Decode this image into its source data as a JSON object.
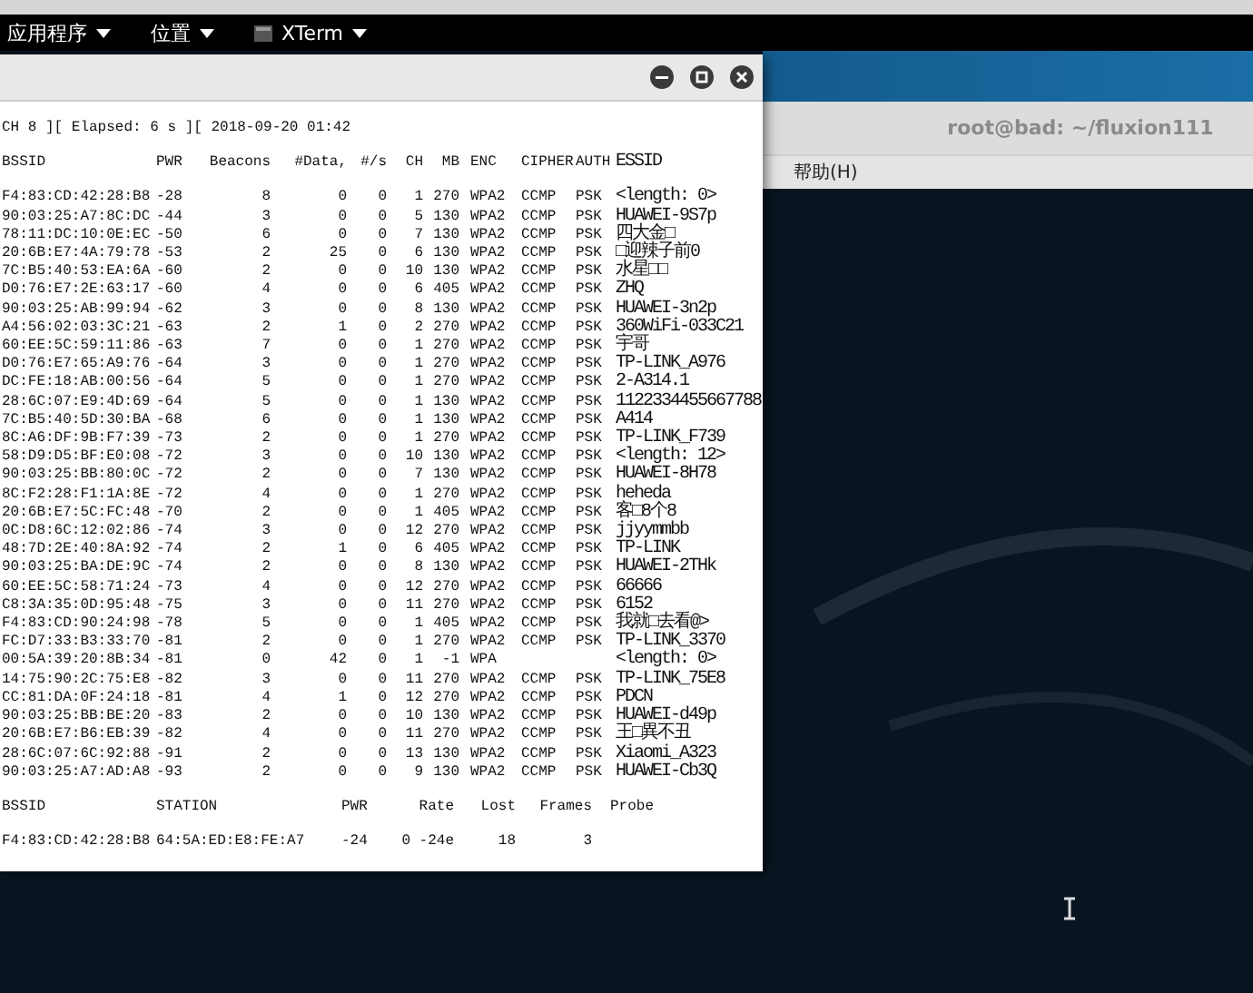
{
  "top_bar": {
    "menus": [
      {
        "label": "应用程序",
        "kind": "menu"
      },
      {
        "label": "位置",
        "kind": "menu"
      },
      {
        "label": "XTerm",
        "kind": "app"
      }
    ]
  },
  "back_window": {
    "title": "root@bad: ~/fluxion111",
    "menu": [
      "帮助(H)"
    ]
  },
  "xterm": {
    "status_line": "CH  8 ][ Elapsed: 6 s ][ 2018-09-20 01:42",
    "ap_columns": [
      "BSSID",
      "PWR",
      "Beacons",
      "#Data,",
      "#/s",
      "CH",
      "MB",
      "ENC",
      "CIPHER",
      "AUTH",
      "ESSID"
    ],
    "ap_rows": [
      {
        "bssid": "F4:83:CD:42:28:B8",
        "pwr": "-28",
        "beacons": "8",
        "data": "0",
        "per_s": "0",
        "ch": "1",
        "mb": "270",
        "enc": "WPA2",
        "cipher": "CCMP",
        "auth": "PSK",
        "essid": "<length:  0>"
      },
      {
        "bssid": "90:03:25:A7:8C:DC",
        "pwr": "-44",
        "beacons": "3",
        "data": "0",
        "per_s": "0",
        "ch": "5",
        "mb": "130",
        "enc": "WPA2",
        "cipher": "CCMP",
        "auth": "PSK",
        "essid": "HUAWEI-9S7p"
      },
      {
        "bssid": "78:11:DC:10:0E:EC",
        "pwr": "-50",
        "beacons": "6",
        "data": "0",
        "per_s": "0",
        "ch": "7",
        "mb": "130",
        "enc": "WPA2",
        "cipher": "CCMP",
        "auth": "PSK",
        "essid": "四大金□"
      },
      {
        "bssid": "20:6B:E7:4A:79:78",
        "pwr": "-53",
        "beacons": "2",
        "data": "25",
        "per_s": "0",
        "ch": "6",
        "mb": "130",
        "enc": "WPA2",
        "cipher": "CCMP",
        "auth": "PSK",
        "essid": "□迎辣子前0"
      },
      {
        "bssid": "7C:B5:40:53:EA:6A",
        "pwr": "-60",
        "beacons": "2",
        "data": "0",
        "per_s": "0",
        "ch": "10",
        "mb": "130",
        "enc": "WPA2",
        "cipher": "CCMP",
        "auth": "PSK",
        "essid": "水星□□"
      },
      {
        "bssid": "D0:76:E7:2E:63:17",
        "pwr": "-60",
        "beacons": "4",
        "data": "0",
        "per_s": "0",
        "ch": "6",
        "mb": "405",
        "enc": "WPA2",
        "cipher": "CCMP",
        "auth": "PSK",
        "essid": "ZHQ"
      },
      {
        "bssid": "90:03:25:AB:99:94",
        "pwr": "-62",
        "beacons": "3",
        "data": "0",
        "per_s": "0",
        "ch": "8",
        "mb": "130",
        "enc": "WPA2",
        "cipher": "CCMP",
        "auth": "PSK",
        "essid": "HUAWEI-3n2p"
      },
      {
        "bssid": "A4:56:02:03:3C:21",
        "pwr": "-63",
        "beacons": "2",
        "data": "1",
        "per_s": "0",
        "ch": "2",
        "mb": "270",
        "enc": "WPA2",
        "cipher": "CCMP",
        "auth": "PSK",
        "essid": "360WiFi-033C21"
      },
      {
        "bssid": "60:EE:5C:59:11:86",
        "pwr": "-63",
        "beacons": "7",
        "data": "0",
        "per_s": "0",
        "ch": "1",
        "mb": "270",
        "enc": "WPA2",
        "cipher": "CCMP",
        "auth": "PSK",
        "essid": "宇哥"
      },
      {
        "bssid": "D0:76:E7:65:A9:76",
        "pwr": "-64",
        "beacons": "3",
        "data": "0",
        "per_s": "0",
        "ch": "1",
        "mb": "270",
        "enc": "WPA2",
        "cipher": "CCMP",
        "auth": "PSK",
        "essid": "TP-LINK_A976"
      },
      {
        "bssid": "DC:FE:18:AB:00:56",
        "pwr": "-64",
        "beacons": "5",
        "data": "0",
        "per_s": "0",
        "ch": "1",
        "mb": "270",
        "enc": "WPA2",
        "cipher": "CCMP",
        "auth": "PSK",
        "essid": "2-A314.1"
      },
      {
        "bssid": "28:6C:07:E9:4D:69",
        "pwr": "-64",
        "beacons": "5",
        "data": "0",
        "per_s": "0",
        "ch": "1",
        "mb": "130",
        "enc": "WPA2",
        "cipher": "CCMP",
        "auth": "PSK",
        "essid": "1122334455667788"
      },
      {
        "bssid": "7C:B5:40:5D:30:BA",
        "pwr": "-68",
        "beacons": "6",
        "data": "0",
        "per_s": "0",
        "ch": "1",
        "mb": "130",
        "enc": "WPA2",
        "cipher": "CCMP",
        "auth": "PSK",
        "essid": "A414"
      },
      {
        "bssid": "8C:A6:DF:9B:F7:39",
        "pwr": "-73",
        "beacons": "2",
        "data": "0",
        "per_s": "0",
        "ch": "1",
        "mb": "270",
        "enc": "WPA2",
        "cipher": "CCMP",
        "auth": "PSK",
        "essid": "TP-LINK_F739"
      },
      {
        "bssid": "58:D9:D5:BF:E0:08",
        "pwr": "-72",
        "beacons": "3",
        "data": "0",
        "per_s": "0",
        "ch": "10",
        "mb": "130",
        "enc": "WPA2",
        "cipher": "CCMP",
        "auth": "PSK",
        "essid": "<length: 12>"
      },
      {
        "bssid": "90:03:25:BB:80:0C",
        "pwr": "-72",
        "beacons": "2",
        "data": "0",
        "per_s": "0",
        "ch": "7",
        "mb": "130",
        "enc": "WPA2",
        "cipher": "CCMP",
        "auth": "PSK",
        "essid": "HUAWEI-8H78"
      },
      {
        "bssid": "8C:F2:28:F1:1A:8E",
        "pwr": "-72",
        "beacons": "4",
        "data": "0",
        "per_s": "0",
        "ch": "1",
        "mb": "270",
        "enc": "WPA2",
        "cipher": "CCMP",
        "auth": "PSK",
        "essid": "heheda"
      },
      {
        "bssid": "20:6B:E7:5C:FC:48",
        "pwr": "-70",
        "beacons": "2",
        "data": "0",
        "per_s": "0",
        "ch": "1",
        "mb": "405",
        "enc": "WPA2",
        "cipher": "CCMP",
        "auth": "PSK",
        "essid": "客□8个8"
      },
      {
        "bssid": "0C:D8:6C:12:02:86",
        "pwr": "-74",
        "beacons": "3",
        "data": "0",
        "per_s": "0",
        "ch": "12",
        "mb": "270",
        "enc": "WPA2",
        "cipher": "CCMP",
        "auth": "PSK",
        "essid": "jjyymmbb"
      },
      {
        "bssid": "48:7D:2E:40:8A:92",
        "pwr": "-74",
        "beacons": "2",
        "data": "1",
        "per_s": "0",
        "ch": "6",
        "mb": "405",
        "enc": "WPA2",
        "cipher": "CCMP",
        "auth": "PSK",
        "essid": "TP-LINK"
      },
      {
        "bssid": "90:03:25:BA:DE:9C",
        "pwr": "-74",
        "beacons": "2",
        "data": "0",
        "per_s": "0",
        "ch": "8",
        "mb": "130",
        "enc": "WPA2",
        "cipher": "CCMP",
        "auth": "PSK",
        "essid": "HUAWEI-2THk"
      },
      {
        "bssid": "60:EE:5C:58:71:24",
        "pwr": "-73",
        "beacons": "4",
        "data": "0",
        "per_s": "0",
        "ch": "12",
        "mb": "270",
        "enc": "WPA2",
        "cipher": "CCMP",
        "auth": "PSK",
        "essid": "66666"
      },
      {
        "bssid": "C8:3A:35:0D:95:48",
        "pwr": "-75",
        "beacons": "3",
        "data": "0",
        "per_s": "0",
        "ch": "11",
        "mb": "270",
        "enc": "WPA2",
        "cipher": "CCMP",
        "auth": "PSK",
        "essid": "6152"
      },
      {
        "bssid": "F4:83:CD:90:24:98",
        "pwr": "-78",
        "beacons": "5",
        "data": "0",
        "per_s": "0",
        "ch": "1",
        "mb": "405",
        "enc": "WPA2",
        "cipher": "CCMP",
        "auth": "PSK",
        "essid": "我就□去看@>"
      },
      {
        "bssid": "FC:D7:33:B3:33:70",
        "pwr": "-81",
        "beacons": "2",
        "data": "0",
        "per_s": "0",
        "ch": "1",
        "mb": "270",
        "enc": "WPA2",
        "cipher": "CCMP",
        "auth": "PSK",
        "essid": "TP-LINK_3370"
      },
      {
        "bssid": "00:5A:39:20:8B:34",
        "pwr": "-81",
        "beacons": "0",
        "data": "42",
        "per_s": "0",
        "ch": "1",
        "mb": "-1",
        "enc": "WPA",
        "essid": "<length:  0>"
      },
      {
        "bssid": "14:75:90:2C:75:E8",
        "pwr": "-82",
        "beacons": "3",
        "data": "0",
        "per_s": "0",
        "ch": "11",
        "mb": "270",
        "enc": "WPA2",
        "cipher": "CCMP",
        "auth": "PSK",
        "essid": "TP-LINK_75E8"
      },
      {
        "bssid": "CC:81:DA:0F:24:18",
        "pwr": "-81",
        "beacons": "4",
        "data": "1",
        "per_s": "0",
        "ch": "12",
        "mb": "270",
        "enc": "WPA2",
        "cipher": "CCMP",
        "auth": "PSK",
        "essid": "PDCN"
      },
      {
        "bssid": "90:03:25:BB:BE:20",
        "pwr": "-83",
        "beacons": "2",
        "data": "0",
        "per_s": "0",
        "ch": "10",
        "mb": "130",
        "enc": "WPA2",
        "cipher": "CCMP",
        "auth": "PSK",
        "essid": "HUAWEI-d49p"
      },
      {
        "bssid": "20:6B:E7:B6:EB:39",
        "pwr": "-82",
        "beacons": "4",
        "data": "0",
        "per_s": "0",
        "ch": "11",
        "mb": "270",
        "enc": "WPA2",
        "cipher": "CCMP",
        "auth": "PSK",
        "essid": "王□異不丑"
      },
      {
        "bssid": "28:6C:07:6C:92:88",
        "pwr": "-91",
        "beacons": "2",
        "data": "0",
        "per_s": "0",
        "ch": "13",
        "mb": "130",
        "enc": "WPA2",
        "cipher": "CCMP",
        "auth": "PSK",
        "essid": "Xiaomi_A323"
      },
      {
        "bssid": "90:03:25:A7:AD:A8",
        "pwr": "-93",
        "beacons": "2",
        "data": "0",
        "per_s": "0",
        "ch": "9",
        "mb": "130",
        "enc": "WPA2",
        "cipher": "CCMP",
        "auth": "PSK",
        "essid": "HUAWEI-Cb3Q"
      }
    ],
    "station_columns": [
      "BSSID",
      "STATION",
      "PWR",
      "Rate",
      "Lost",
      "Frames",
      "Probe"
    ],
    "station_rows": [
      {
        "bssid": "F4:83:CD:42:28:B8",
        "station": "64:5A:ED:E8:FE:A7",
        "pwr": "-24",
        "rate": "0 -24e",
        "lost": "18",
        "frames": "3"
      }
    ]
  }
}
